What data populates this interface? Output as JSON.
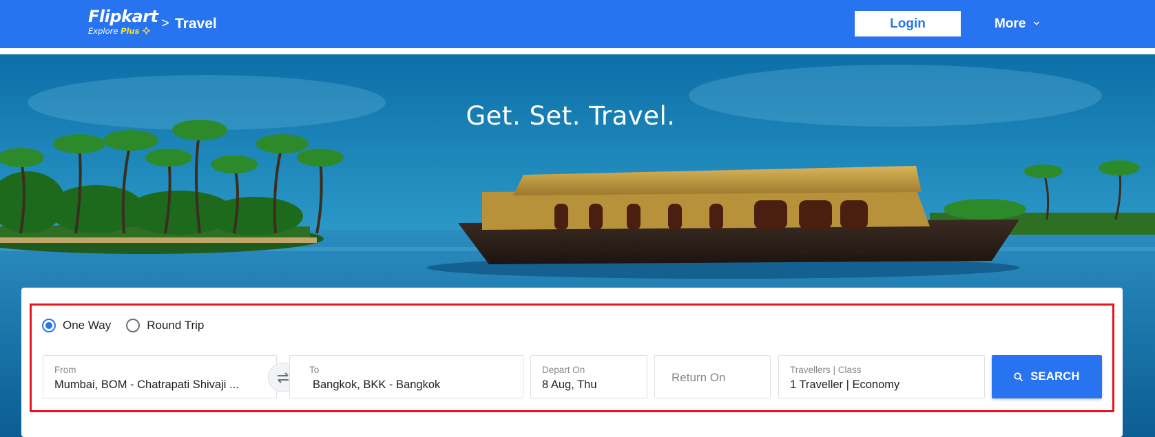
{
  "header": {
    "logo_name": "Flipkart",
    "logo_sub_prefix": "Explore",
    "logo_sub_plus": "Plus",
    "breadcrumb_separator": ">",
    "breadcrumb_current": "Travel",
    "login_label": "Login",
    "more_label": "More",
    "more_icon": "chevron-down-icon"
  },
  "hero": {
    "tagline": "Get. Set. Travel.",
    "image": "kerala-houseboat-backwaters"
  },
  "search": {
    "trip_types": [
      {
        "label": "One Way",
        "selected": true
      },
      {
        "label": "Round Trip",
        "selected": false
      }
    ],
    "from": {
      "label": "From",
      "value": "Mumbai, BOM - Chatrapati Shivaji ..."
    },
    "swap_icon": "swap-arrows-icon",
    "to": {
      "label": "To",
      "value": "Bangkok, BKK - Bangkok"
    },
    "depart": {
      "label": "Depart On",
      "value": "8 Aug, Thu"
    },
    "return": {
      "placeholder": "Return On"
    },
    "travellers": {
      "label": "Travellers | Class",
      "value": "1 Traveller | Economy"
    },
    "search_label": "SEARCH",
    "search_icon": "search-icon"
  },
  "colors": {
    "brand_blue": "#2874f0",
    "plus_yellow": "#ffe11b",
    "highlight_red": "#e5151c"
  }
}
